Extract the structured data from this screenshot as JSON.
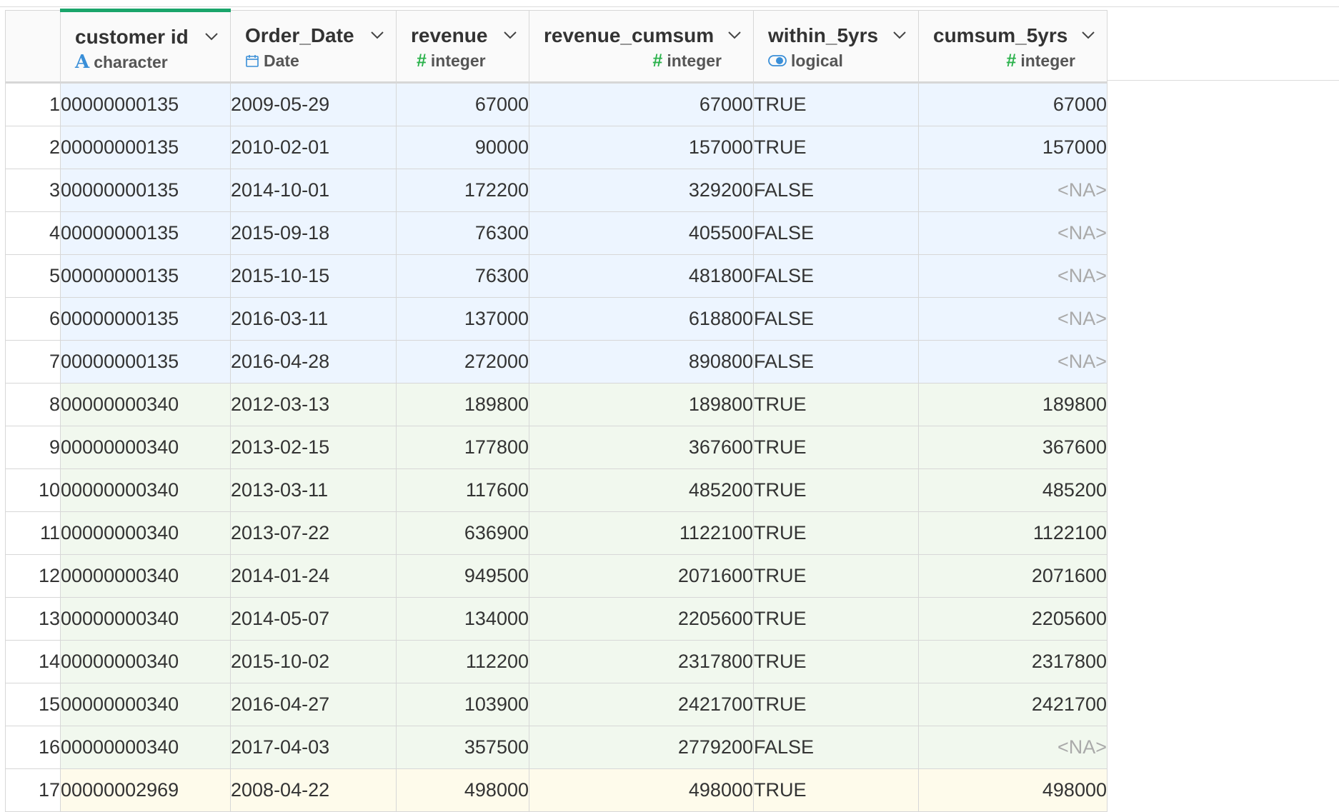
{
  "columns": [
    {
      "name": "customer id",
      "type": "character",
      "type_icon": "character-icon"
    },
    {
      "name": "Order_Date",
      "type": "Date",
      "type_icon": "calendar-icon"
    },
    {
      "name": "revenue",
      "type": "integer",
      "type_icon": "hash-icon"
    },
    {
      "name": "revenue_cumsum",
      "type": "integer",
      "type_icon": "hash-icon"
    },
    {
      "name": "within_5yrs",
      "type": "logical",
      "type_icon": "toggle-icon"
    },
    {
      "name": "cumsum_5yrs",
      "type": "integer",
      "type_icon": "hash-icon"
    }
  ],
  "colors": {
    "active_column": "#1aa56b",
    "group1_bg": "#edf5ff",
    "group2_bg": "#f1f8ee",
    "group3_bg": "#fefbeb",
    "na_text": "#aaaaaa",
    "character_icon": "#3a8fd8",
    "integer_icon": "#2bb24c"
  },
  "rows": [
    {
      "n": "1",
      "group": "g1",
      "customer_id": "00000000135",
      "order_date": "2009-05-29",
      "revenue": "67000",
      "revenue_cumsum": "67000",
      "within_5yrs": "TRUE",
      "cumsum_5yrs": "67000"
    },
    {
      "n": "2",
      "group": "g1",
      "customer_id": "00000000135",
      "order_date": "2010-02-01",
      "revenue": "90000",
      "revenue_cumsum": "157000",
      "within_5yrs": "TRUE",
      "cumsum_5yrs": "157000"
    },
    {
      "n": "3",
      "group": "g1",
      "customer_id": "00000000135",
      "order_date": "2014-10-01",
      "revenue": "172200",
      "revenue_cumsum": "329200",
      "within_5yrs": "FALSE",
      "cumsum_5yrs": "<NA>"
    },
    {
      "n": "4",
      "group": "g1",
      "customer_id": "00000000135",
      "order_date": "2015-09-18",
      "revenue": "76300",
      "revenue_cumsum": "405500",
      "within_5yrs": "FALSE",
      "cumsum_5yrs": "<NA>"
    },
    {
      "n": "5",
      "group": "g1",
      "customer_id": "00000000135",
      "order_date": "2015-10-15",
      "revenue": "76300",
      "revenue_cumsum": "481800",
      "within_5yrs": "FALSE",
      "cumsum_5yrs": "<NA>"
    },
    {
      "n": "6",
      "group": "g1",
      "customer_id": "00000000135",
      "order_date": "2016-03-11",
      "revenue": "137000",
      "revenue_cumsum": "618800",
      "within_5yrs": "FALSE",
      "cumsum_5yrs": "<NA>"
    },
    {
      "n": "7",
      "group": "g1",
      "customer_id": "00000000135",
      "order_date": "2016-04-28",
      "revenue": "272000",
      "revenue_cumsum": "890800",
      "within_5yrs": "FALSE",
      "cumsum_5yrs": "<NA>"
    },
    {
      "n": "8",
      "group": "g2",
      "customer_id": "00000000340",
      "order_date": "2012-03-13",
      "revenue": "189800",
      "revenue_cumsum": "189800",
      "within_5yrs": "TRUE",
      "cumsum_5yrs": "189800"
    },
    {
      "n": "9",
      "group": "g2",
      "customer_id": "00000000340",
      "order_date": "2013-02-15",
      "revenue": "177800",
      "revenue_cumsum": "367600",
      "within_5yrs": "TRUE",
      "cumsum_5yrs": "367600"
    },
    {
      "n": "10",
      "group": "g2",
      "customer_id": "00000000340",
      "order_date": "2013-03-11",
      "revenue": "117600",
      "revenue_cumsum": "485200",
      "within_5yrs": "TRUE",
      "cumsum_5yrs": "485200"
    },
    {
      "n": "11",
      "group": "g2",
      "customer_id": "00000000340",
      "order_date": "2013-07-22",
      "revenue": "636900",
      "revenue_cumsum": "1122100",
      "within_5yrs": "TRUE",
      "cumsum_5yrs": "1122100"
    },
    {
      "n": "12",
      "group": "g2",
      "customer_id": "00000000340",
      "order_date": "2014-01-24",
      "revenue": "949500",
      "revenue_cumsum": "2071600",
      "within_5yrs": "TRUE",
      "cumsum_5yrs": "2071600"
    },
    {
      "n": "13",
      "group": "g2",
      "customer_id": "00000000340",
      "order_date": "2014-05-07",
      "revenue": "134000",
      "revenue_cumsum": "2205600",
      "within_5yrs": "TRUE",
      "cumsum_5yrs": "2205600"
    },
    {
      "n": "14",
      "group": "g2",
      "customer_id": "00000000340",
      "order_date": "2015-10-02",
      "revenue": "112200",
      "revenue_cumsum": "2317800",
      "within_5yrs": "TRUE",
      "cumsum_5yrs": "2317800"
    },
    {
      "n": "15",
      "group": "g2",
      "customer_id": "00000000340",
      "order_date": "2016-04-27",
      "revenue": "103900",
      "revenue_cumsum": "2421700",
      "within_5yrs": "TRUE",
      "cumsum_5yrs": "2421700"
    },
    {
      "n": "16",
      "group": "g2",
      "customer_id": "00000000340",
      "order_date": "2017-04-03",
      "revenue": "357500",
      "revenue_cumsum": "2779200",
      "within_5yrs": "FALSE",
      "cumsum_5yrs": "<NA>"
    },
    {
      "n": "17",
      "group": "g3",
      "customer_id": "00000002969",
      "order_date": "2008-04-22",
      "revenue": "498000",
      "revenue_cumsum": "498000",
      "within_5yrs": "TRUE",
      "cumsum_5yrs": "498000"
    }
  ]
}
